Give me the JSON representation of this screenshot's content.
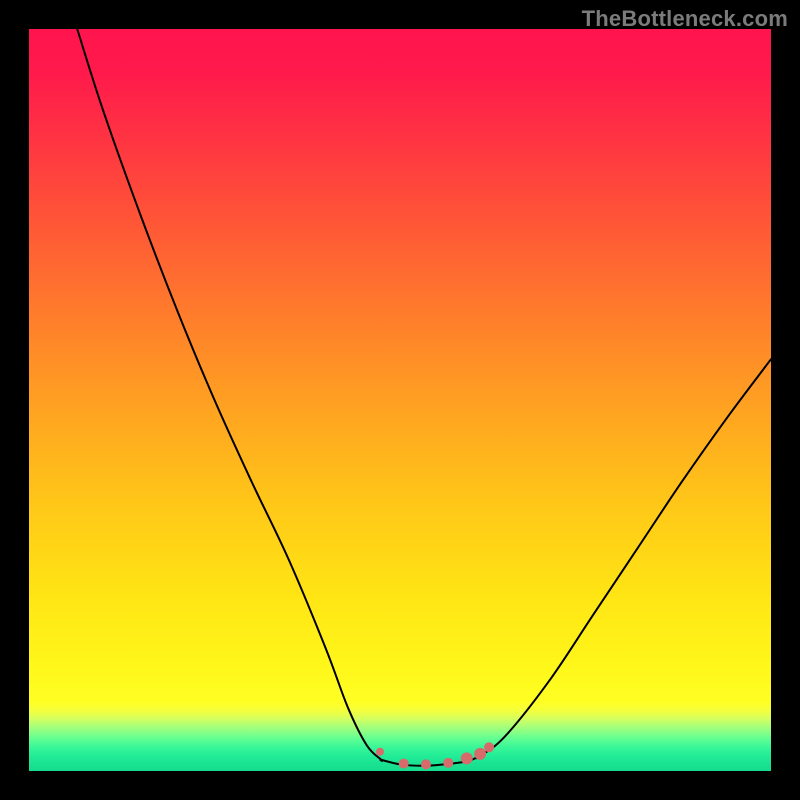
{
  "watermark": "TheBottleneck.com",
  "accent_dot_color": "#d76a6a",
  "curve_color": "#000000",
  "gradient_stops": [
    {
      "offset": 0.0,
      "color": "#ff144e"
    },
    {
      "offset": 0.06,
      "color": "#ff1a4b"
    },
    {
      "offset": 0.16,
      "color": "#ff3741"
    },
    {
      "offset": 0.28,
      "color": "#ff5c35"
    },
    {
      "offset": 0.4,
      "color": "#ff812a"
    },
    {
      "offset": 0.52,
      "color": "#ffa520"
    },
    {
      "offset": 0.64,
      "color": "#ffc718"
    },
    {
      "offset": 0.76,
      "color": "#ffe414"
    },
    {
      "offset": 0.86,
      "color": "#fff71a"
    },
    {
      "offset": 0.906,
      "color": "#ffff24"
    },
    {
      "offset": 0.912,
      "color": "#fcff2e"
    },
    {
      "offset": 0.918,
      "color": "#f4ff3c"
    },
    {
      "offset": 0.924,
      "color": "#e6ff4d"
    },
    {
      "offset": 0.93,
      "color": "#d2ff60"
    },
    {
      "offset": 0.936,
      "color": "#b8ff72"
    },
    {
      "offset": 0.944,
      "color": "#98ff81"
    },
    {
      "offset": 0.952,
      "color": "#74ff8d"
    },
    {
      "offset": 0.961,
      "color": "#50fc95"
    },
    {
      "offset": 0.97,
      "color": "#34f598"
    },
    {
      "offset": 0.98,
      "color": "#22ec97"
    },
    {
      "offset": 0.99,
      "color": "#19e392"
    },
    {
      "offset": 1.0,
      "color": "#17dc8d"
    }
  ],
  "chart_data": {
    "type": "line",
    "title": "",
    "xlabel": "",
    "ylabel": "",
    "xlim": [
      0,
      100
    ],
    "ylim": [
      0,
      100
    ],
    "series": [
      {
        "name": "left-branch",
        "x": [
          6.5,
          10,
          15,
          20,
          25,
          30,
          35,
          40,
          43,
          45.5,
          47.5
        ],
        "y": [
          100,
          89,
          75,
          62,
          50,
          39,
          28.5,
          16.5,
          8.5,
          3.5,
          1.5
        ]
      },
      {
        "name": "floor",
        "x": [
          47.5,
          50,
          53,
          56,
          59,
          60.5
        ],
        "y": [
          1.5,
          0.9,
          0.7,
          0.9,
          1.3,
          1.9
        ]
      },
      {
        "name": "right-branch",
        "x": [
          60.5,
          64,
          70,
          76,
          82,
          88,
          94,
          100
        ],
        "y": [
          1.9,
          4.5,
          12,
          21,
          30,
          39,
          47.5,
          55.5
        ]
      }
    ],
    "markers": [
      {
        "name": "dot-left-edge",
        "x": 47.3,
        "y": 2.6,
        "r": 4
      },
      {
        "name": "dot-floor-1",
        "x": 50.5,
        "y": 1.0,
        "r": 5
      },
      {
        "name": "dot-floor-2",
        "x": 53.5,
        "y": 0.9,
        "r": 5
      },
      {
        "name": "dot-floor-3",
        "x": 56.5,
        "y": 1.1,
        "r": 5
      },
      {
        "name": "dot-right-rise-1",
        "x": 59.0,
        "y": 1.7,
        "r": 6
      },
      {
        "name": "dot-right-rise-2",
        "x": 60.8,
        "y": 2.3,
        "r": 6
      },
      {
        "name": "dot-right-rise-3",
        "x": 62.0,
        "y": 3.2,
        "r": 5
      }
    ]
  }
}
